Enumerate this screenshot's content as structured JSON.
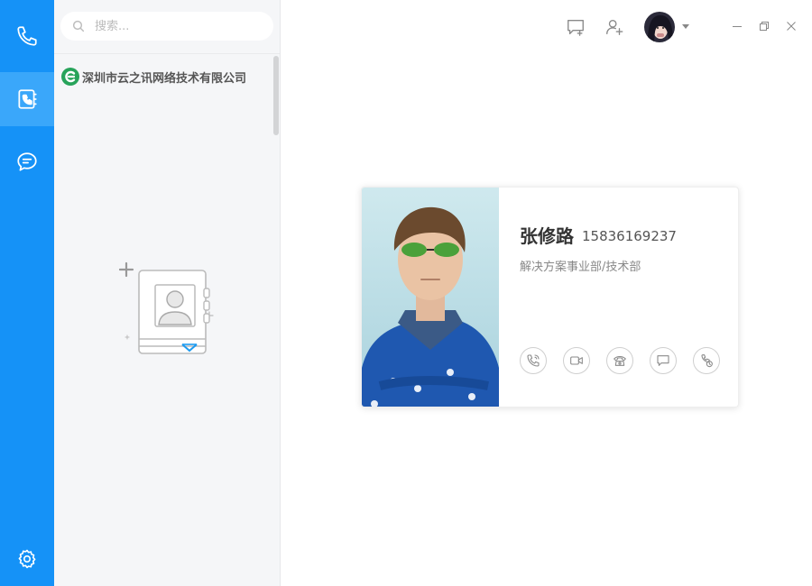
{
  "search": {
    "placeholder": "搜索..."
  },
  "org": {
    "name": "深圳市云之讯网络技术有限公司"
  },
  "nav": {
    "items": [
      {
        "icon": "phone-icon"
      },
      {
        "icon": "contacts-book-icon",
        "active": true
      },
      {
        "icon": "chat-bubble-icon"
      }
    ],
    "settings_icon": "gear-icon"
  },
  "topbar": {
    "icons": [
      "new-chat-icon",
      "add-contact-icon"
    ],
    "window_controls": [
      "minimize-icon",
      "restore-icon",
      "close-icon"
    ]
  },
  "contact": {
    "name": "张修路",
    "phone": "15836169237",
    "department": "解决方案事业部/技术部",
    "actions": [
      "voice-call-icon",
      "video-call-icon",
      "landline-call-icon",
      "message-icon",
      "callback-icon"
    ]
  },
  "colors": {
    "rail": "#1592f7",
    "rail_active": "#3aa7fa",
    "org_logo": "#27a35a"
  }
}
